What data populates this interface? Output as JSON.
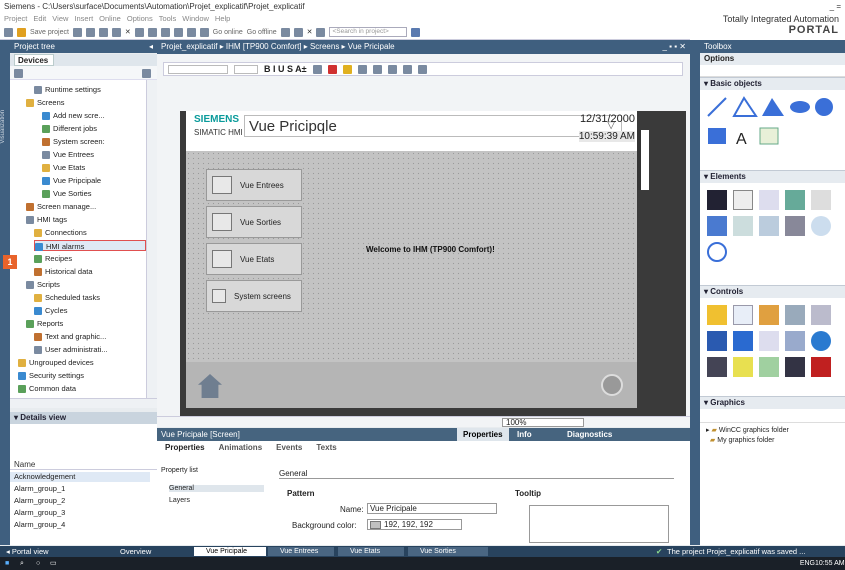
{
  "window": {
    "title": "Siemens  -  C:\\Users\\surface\\Documents\\Automation\\Projet_explicatif\\Projet_explicatif",
    "close": "_ ="
  },
  "menu": [
    "Project",
    "Edit",
    "View",
    "Insert",
    "Online",
    "Options",
    "Tools",
    "Window",
    "Help"
  ],
  "toolbar": {
    "save_label": "Save project",
    "go_online": "Go online",
    "go_offline": "Go offline",
    "search_placeholder": "<Search in project>"
  },
  "brand": {
    "line1": "Totally Integrated Automation",
    "line2": "PORTAL"
  },
  "project_tree": {
    "title": "Project tree",
    "tab": "Devices",
    "items": [
      {
        "label": "Runtime settings",
        "indent": 3
      },
      {
        "label": "Screens",
        "indent": 2
      },
      {
        "label": "Add new scre...",
        "indent": 4
      },
      {
        "label": "Different jobs",
        "indent": 4
      },
      {
        "label": "System screen:",
        "indent": 4
      },
      {
        "label": "Vue Entrees",
        "indent": 4
      },
      {
        "label": "Vue Etats",
        "indent": 4
      },
      {
        "label": "Vue Pripcipale",
        "indent": 4
      },
      {
        "label": "Vue Sorties",
        "indent": 4
      },
      {
        "label": "Screen manage...",
        "indent": 2
      },
      {
        "label": "HMI tags",
        "indent": 2
      },
      {
        "label": "Connections",
        "indent": 3
      },
      {
        "label": "HMI alarms",
        "indent": 3
      },
      {
        "label": "Recipes",
        "indent": 3
      },
      {
        "label": "Historical data",
        "indent": 3
      },
      {
        "label": "Scripts",
        "indent": 2
      },
      {
        "label": "Scheduled tasks",
        "indent": 3
      },
      {
        "label": "Cycles",
        "indent": 3
      },
      {
        "label": "Reports",
        "indent": 2
      },
      {
        "label": "Text and graphic...",
        "indent": 3
      },
      {
        "label": "User administrati...",
        "indent": 3
      },
      {
        "label": "Ungrouped devices",
        "indent": 1
      },
      {
        "label": "Security settings",
        "indent": 1
      },
      {
        "label": "Common data",
        "indent": 1
      }
    ],
    "badge": "1",
    "side_label": "Visualization"
  },
  "details": {
    "title": "Details view",
    "col_name": "Name",
    "rows": [
      "Acknowledgement",
      "Alarm_group_1",
      "Alarm_group_2",
      "Alarm_group_3",
      "Alarm_group_4"
    ]
  },
  "breadcrumb": "Projet_explicatif  ▸  IHM [TP900 Comfort]  ▸  Screens  ▸  Vue Pricipale",
  "editor_toolbar": {
    "font_buttons": "B  I  U  S  A±"
  },
  "hmi": {
    "siemens": "SIEMENS",
    "simatic": "SIMATIC HMI",
    "screen_title": "Vue Pricipqle",
    "date": "12/31/2000",
    "time": "10:59:39 AM",
    "buttons": [
      "Vue Entrees",
      "Vue Sorties",
      "Vue Etats",
      "System screens"
    ],
    "welcome": "Welcome to IHM (TP900 Comfort)!"
  },
  "zoom": "100%",
  "inspector": {
    "title": "Vue Pricipale [Screen]",
    "top_tabs": [
      "Properties",
      "Info",
      "Diagnostics"
    ],
    "tabs": [
      "Properties",
      "Animations",
      "Events",
      "Texts"
    ],
    "left": [
      "Property list",
      "General",
      "Layers"
    ],
    "section": "General",
    "pattern": "Pattern",
    "tooltip": "Tooltip",
    "name_label": "Name:",
    "name_value": "Vue Pricipale",
    "bg_label": "Background color:",
    "bg_value": "192, 192, 192"
  },
  "toolbox": {
    "title": "Toolbox",
    "options": "Options",
    "sections": [
      "Basic objects",
      "Elements",
      "Controls",
      "Graphics"
    ],
    "graphics_items": [
      "WinCC graphics folder",
      "My graphics folder"
    ]
  },
  "status": {
    "portal_view": "Portal view",
    "overview": "Overview",
    "tabs": [
      "Vue Pricipale",
      "Vue Entrees",
      "Vue Etats",
      "Vue Sorties"
    ],
    "message": "The project Projet_explicatif was saved ..."
  },
  "taskbar": {
    "lang": "ENG",
    "time": "10:55 AM"
  }
}
